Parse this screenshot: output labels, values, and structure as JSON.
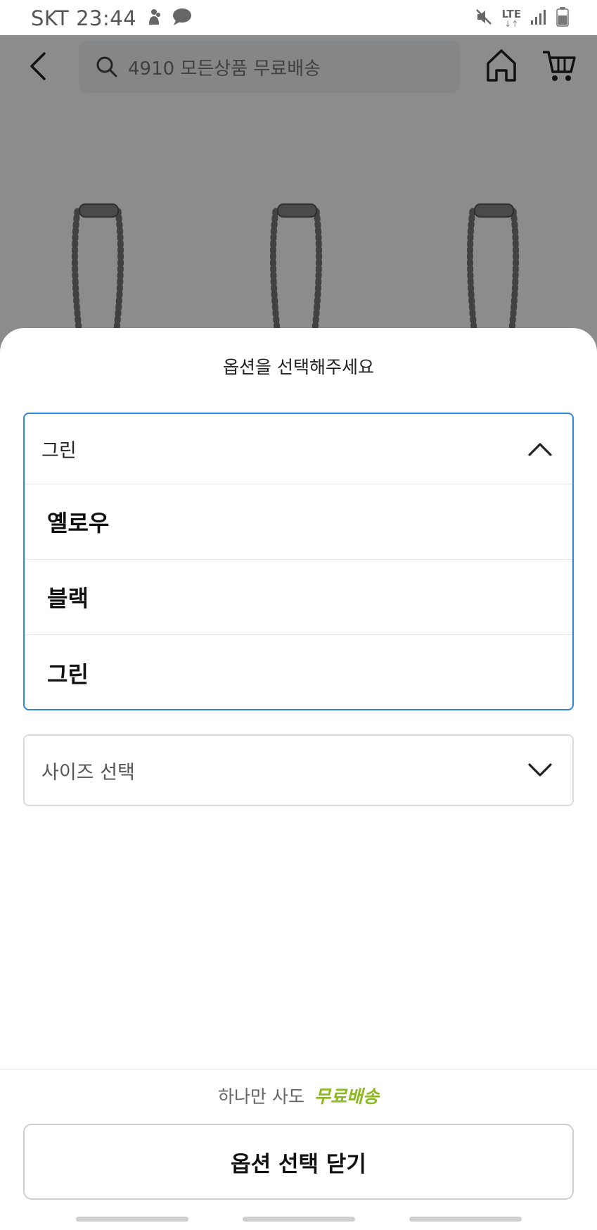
{
  "status_bar": {
    "carrier_time": "SKT 23:44",
    "network": "LTE"
  },
  "header": {
    "search_placeholder": "4910 모든상품 무료배송",
    "icons": [
      "back-arrow-icon",
      "search-icon",
      "home-icon",
      "cart-icon"
    ]
  },
  "sheet": {
    "title": "옵션을 선택해주세요",
    "color_select": {
      "selected": "그린",
      "options": [
        "옐로우",
        "블랙",
        "그린"
      ]
    },
    "size_select": {
      "placeholder": "사이즈 선택"
    },
    "shipping_note": {
      "prefix": "하나만 사도",
      "highlight": "무료배송"
    },
    "close_button_label": "옵션 선택 닫기"
  },
  "colors": {
    "accent_border": "#2f86d6",
    "free_shipping": "#8ab81e"
  }
}
